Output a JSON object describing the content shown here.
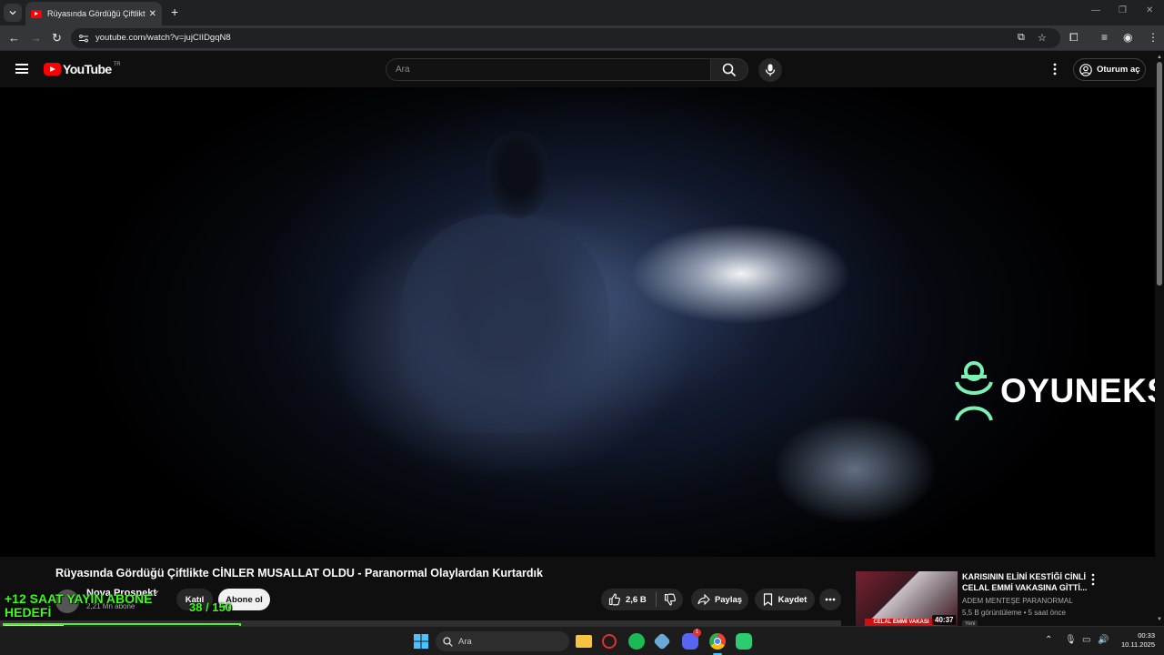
{
  "browser": {
    "tab_title": "Rüyasında Gördüğü Çiftlikte Cİ",
    "url": "youtube.com/watch?v=jujCIIDgqN8"
  },
  "header": {
    "logo_text": "YouTube",
    "country_code": "TR",
    "search_placeholder": "Ara",
    "signin_label": "Oturum aç"
  },
  "video": {
    "watermark": "OYUNEKS",
    "title": "Rüyasında Gördüğü Çiftlikte CİNLER MUSALLAT OLDU - Paranormal Olaylardan Kurtardık",
    "channel_name": "Nova Prospekt",
    "subscribers": "2,21 Mn abone",
    "join_label": "Katıl",
    "subscribe_label": "Abone ol",
    "like_count": "2,6 B",
    "share_label": "Paylaş",
    "save_label": "Kaydet"
  },
  "recommended": {
    "title": "KARISININ ELİNİ KESTİĞİ CİNLİ CELAL EMMİ VAKASINA GİTTİ...",
    "channel": "ADEM MENTEŞE PARANORMAL",
    "meta": "5,5 B görüntüleme • 5 saat önce",
    "duration": "40:37",
    "badge": "Yeni",
    "thumb_text": "CELAL EMMİ VAKASI"
  },
  "overlay": {
    "goal_text_line1": "+12 SAAT YAYIN ABONE",
    "goal_text_line2": "HEDEFİ",
    "count": "38  / 150",
    "progress": 0.253
  },
  "taskbar": {
    "search_label": "Ara",
    "time": "00:33",
    "date": "10.11.2025",
    "discord_badge": "1"
  },
  "colors": {
    "youtube_red": "#ff0000",
    "overlay_green": "#39ff14",
    "watermark_green": "#7df0b4"
  }
}
